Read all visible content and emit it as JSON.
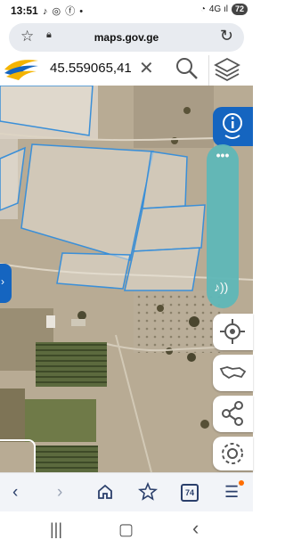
{
  "status": {
    "time": "13:51",
    "icons": "♪ ◎ ⓕ •",
    "signal": "4G ıl",
    "battery": "72"
  },
  "browser": {
    "url": "maps.gov.ge",
    "tab_count": "74"
  },
  "search": {
    "value": "45.559065,41"
  },
  "icons": {
    "star": "bookmark-star-icon",
    "lock": "lock-icon",
    "reload": "reload-icon",
    "clear": "close-icon",
    "search": "search-icon",
    "layers": "layers-icon",
    "info": "info-icon",
    "locate": "locate-icon",
    "country": "georgia-map-icon",
    "share": "share-icon",
    "settings": "gear-icon",
    "sound": "sound-icon"
  },
  "colors": {
    "accent": "#1565c0",
    "panel": "#5fb8b8",
    "parcel_line": "#3a8fd8"
  }
}
